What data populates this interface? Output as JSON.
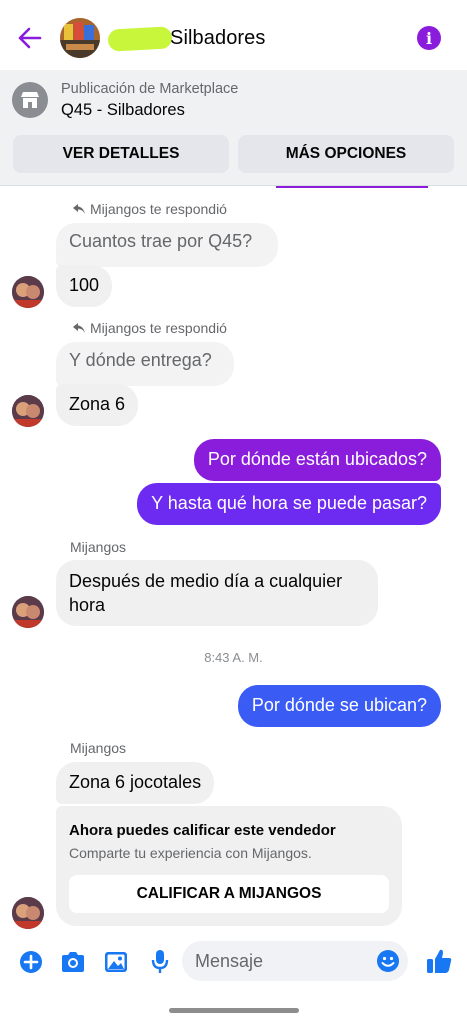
{
  "header": {
    "title": "Silbadores",
    "accent": "#8a1cdb"
  },
  "marketplace": {
    "label": "Publicación de Marketplace",
    "title": "Q45 - Silbadores",
    "details_button": "VER DETALLES",
    "more_button": "MÁS OPCIONES"
  },
  "messages": {
    "reply1_note": "Mijangos te respondió",
    "reply1_quoted": "Cuantos trae por Q45?",
    "reply1_text": "100",
    "reply2_note": "Mijangos te respondió",
    "reply2_quoted": "Y dónde entrega?",
    "reply2_text": "Zona 6",
    "out1": "Por dónde están ubicados?",
    "out2": "Y hasta qué hora se puede pasar?",
    "sender1": "Mijangos",
    "in3_line1": "Después de medio día a cualquier",
    "in3_line2": "hora",
    "timestamp": "8:43 A. M.",
    "out3": "Por dónde se ubican?",
    "sender2": "Mijangos",
    "in4": "Zona 6 jocotales",
    "outgoing_color_top": "#8a1cdb",
    "outgoing_color_bottom": "#3b5bf5"
  },
  "rating": {
    "title": "Ahora puedes calificar este vendedor",
    "subtitle": "Comparte tu experiencia con Mijangos.",
    "button": "CALIFICAR A MIJANGOS"
  },
  "composer": {
    "placeholder": "Mensaje",
    "icons": [
      "plus-icon",
      "camera-icon",
      "gallery-icon",
      "microphone-icon",
      "emoji-icon",
      "thumbs-up-icon"
    ],
    "icon_color": "#1877f2"
  }
}
